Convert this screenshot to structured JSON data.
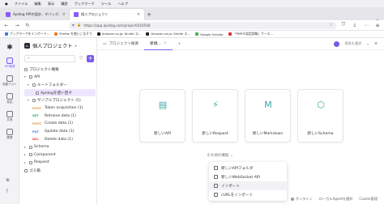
{
  "browser": {
    "menu": [
      "ファイル",
      "編集",
      "表示",
      "履歴",
      "ブックマーク",
      "ツール",
      "ヘルプ"
    ],
    "tabs": [
      {
        "label": "Apidog APIの設計、デバッグ、管理…",
        "active": false
      },
      {
        "label": "個人プロジェクト",
        "active": true
      }
    ],
    "new_tab": "+",
    "url": "https://app.apidog.com/project/416548",
    "bookmarks": [
      "ブックマークをインポート…",
      "Firefox を使いこなそう",
      "Amazon.co.jp: Kindle ス…",
      "Amazon.co.jp: Kindle ス…",
      "Google Scholar",
      "「PMP®認定試験」ケース…"
    ]
  },
  "rail": {
    "items": [
      {
        "label": "API管理",
        "icon": "api-icon",
        "active": true
      },
      {
        "label": "自動テスト",
        "icon": "test-icon",
        "active": false
      },
      {
        "label": "設定",
        "icon": "settings-icon",
        "active": false
      },
      {
        "label": "共有",
        "icon": "share-icon",
        "active": false
      },
      {
        "label": "履歴",
        "icon": "history-icon",
        "active": false
      }
    ]
  },
  "sidebar": {
    "project_name": "個人プロジェクト",
    "search_placeholder": "",
    "tree": [
      {
        "text": "プロジェクト概要",
        "level": 0
      },
      {
        "text": "API",
        "level": 0
      },
      {
        "text": "ルートフォルダー",
        "level": 1
      },
      {
        "text": "Apidogを使い回す",
        "level": 2
      },
      {
        "text": "サンプルプロジェクト (5)",
        "level": 1
      },
      {
        "method": "POST",
        "text": "Token acquisition (1)",
        "level": 2
      },
      {
        "method": "GET",
        "text": "Retrieve data (1)",
        "level": 2
      },
      {
        "method": "POST",
        "text": "Create data (1)",
        "level": 2
      },
      {
        "method": "PUT",
        "text": "Update data (1)",
        "level": 2
      },
      {
        "method": "DEL",
        "text": "Delete data (1)",
        "level": 2
      },
      {
        "text": "Schema",
        "level": 0
      },
      {
        "text": "Component",
        "level": 0
      },
      {
        "text": "Request",
        "level": 0
      },
      {
        "text": "ゴミ箱",
        "level": 0
      }
    ]
  },
  "main": {
    "tabs": [
      {
        "label": "プロジェクト概要",
        "active": false
      },
      {
        "label": "新規...",
        "active": true
      }
    ],
    "env_select": "環境を選択",
    "cards": [
      {
        "label": "新しいAPI",
        "icon": "api-doc-icon"
      },
      {
        "label": "新しいRequest",
        "icon": "lightning-icon"
      },
      {
        "label": "新しいMarkdown",
        "icon": "markdown-icon"
      },
      {
        "label": "新しいSchema",
        "icon": "cube-icon"
      }
    ],
    "more_label": "その他の機能 ⌄",
    "dropdown": [
      {
        "label": "新しいAPIフォルダ",
        "icon": "folder-icon"
      },
      {
        "label": "新しいWebSocket API",
        "icon": "websocket-icon"
      },
      {
        "label": "インポート",
        "icon": "import-icon"
      },
      {
        "label": "cURLをインポート",
        "icon": "curl-icon"
      }
    ],
    "status": [
      "オンライン",
      "ローカルAgentを選択",
      "Cookie管理"
    ]
  }
}
